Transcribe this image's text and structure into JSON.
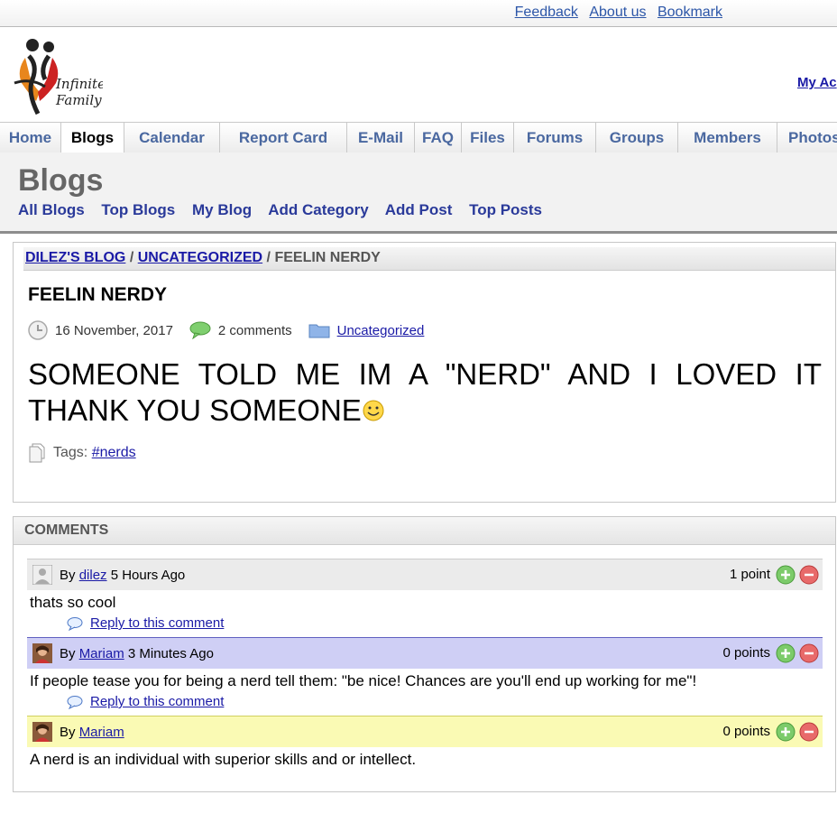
{
  "toplinks": [
    "Feedback",
    "About us",
    "Bookmark"
  ],
  "logo": {
    "line1": "Infinite",
    "line2": "Family"
  },
  "my_account": "My Ac",
  "nav": [
    "Home",
    "Blogs",
    "Calendar",
    "Report Card",
    "E-Mail",
    "FAQ",
    "Files",
    "Forums",
    "Groups",
    "Members",
    "Photos"
  ],
  "nav_active": "Blogs",
  "subheader": {
    "title": "Blogs",
    "links": [
      "All Blogs",
      "Top Blogs",
      "My Blog",
      "Add Category",
      "Add Post",
      "Top Posts"
    ]
  },
  "breadcrumb": {
    "blog": "DILEZ'S BLOG",
    "sep": "/",
    "category": "UNCATEGORIZED",
    "current": "FEELIN NERDY"
  },
  "post": {
    "title": "FEELIN NERDY",
    "date": "16 November, 2017",
    "comments_count": "2 comments",
    "category": "Uncategorized",
    "body": "SOMEONE TOLD ME IM A \"NERD\" AND I LOVED IT THANK YOU SOMEONE",
    "tags_label": "Tags:",
    "tag": "#nerds"
  },
  "comments_header": "COMMENTS",
  "comments": [
    {
      "by": "By",
      "user": "dilez",
      "time": "5 Hours Ago",
      "points": "1 point",
      "text": "thats so cool",
      "reply": "Reply to this comment",
      "bg": "#ebebeb"
    },
    {
      "by": "By",
      "user": "Mariam",
      "time": "3 Minutes Ago",
      "points": "0 points",
      "text": "If people tease you for being a nerd tell them: \"be nice! Chances are you'll end up working for me\"!",
      "reply": "Reply to this comment",
      "bg": "#cfcff5"
    },
    {
      "by": "By",
      "user": "Mariam",
      "time": "",
      "points": "0 points",
      "text": "A nerd is an individual with superior skills and or intellect.",
      "reply": "",
      "bg": "#fafab4"
    }
  ]
}
